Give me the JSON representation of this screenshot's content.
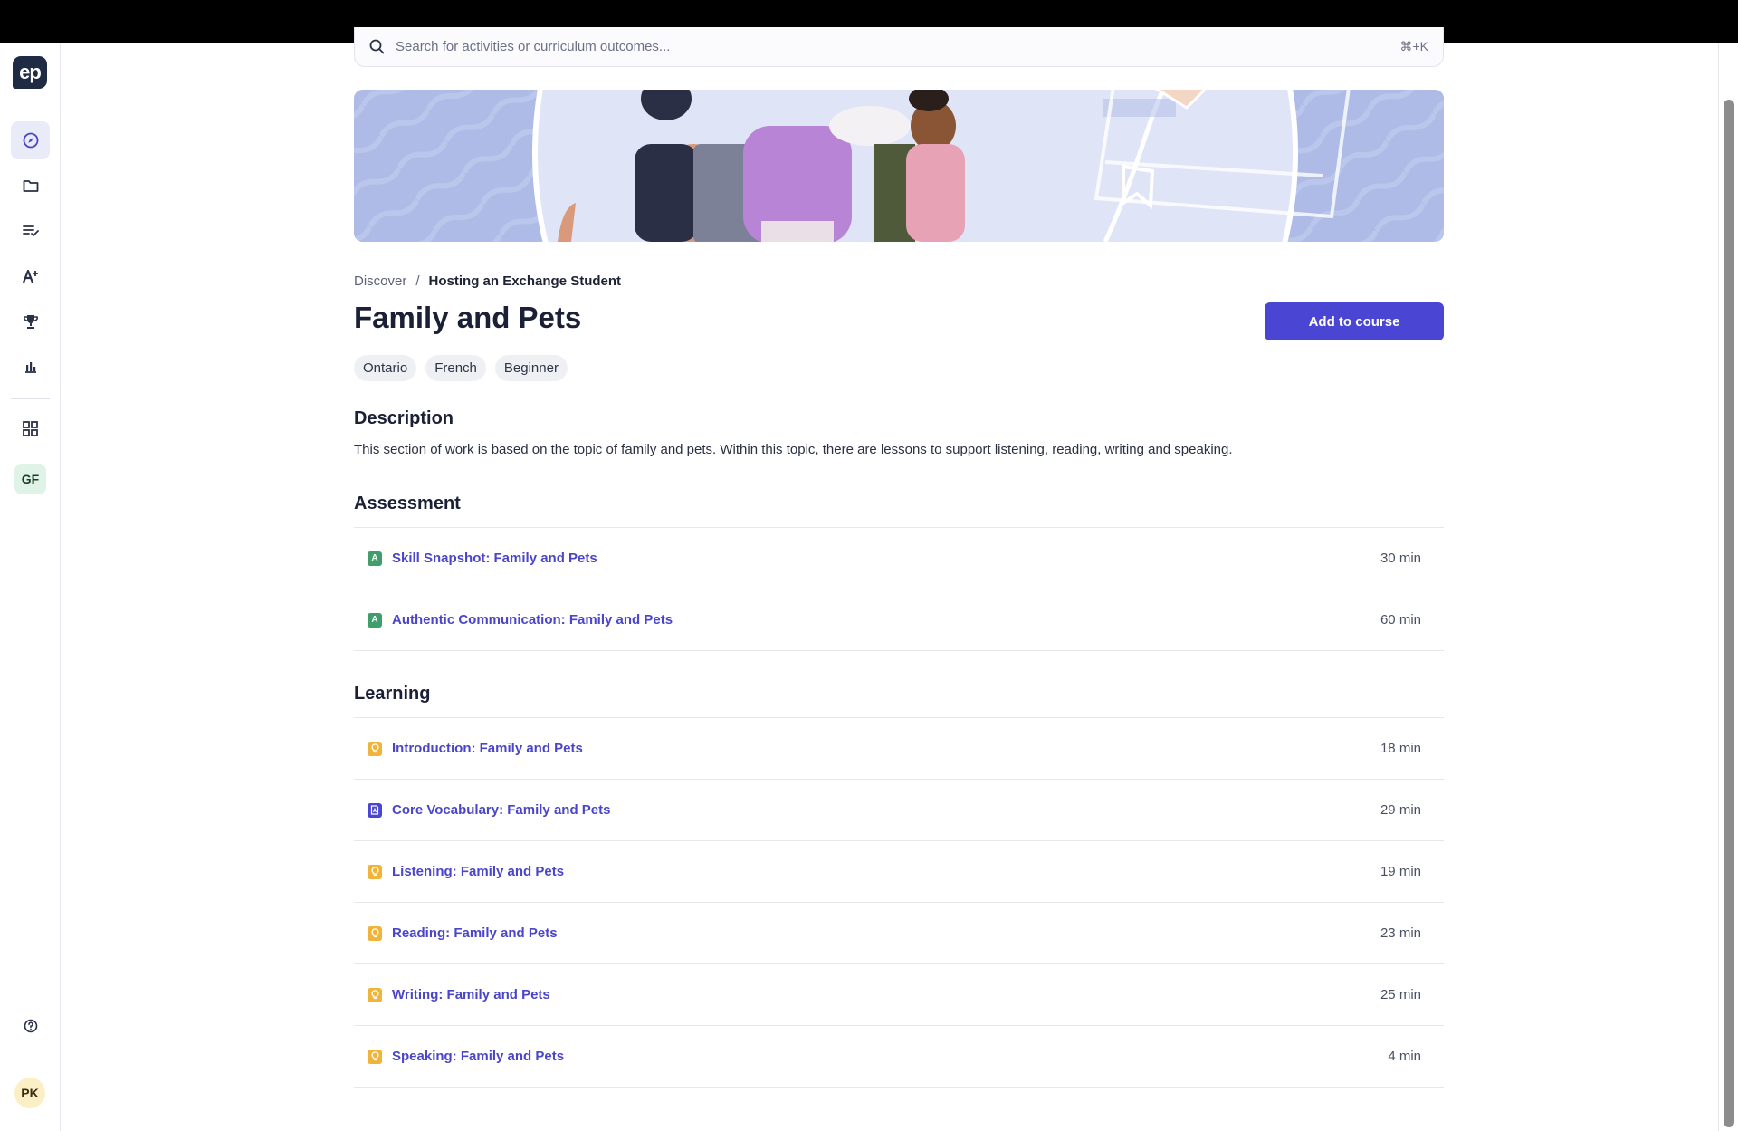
{
  "search": {
    "placeholder": "Search for activities or curriculum outcomes...",
    "shortcut": "⌘+K"
  },
  "sidebar": {
    "logo": "ep",
    "items": [
      {
        "icon": "compass-icon",
        "active": true
      },
      {
        "icon": "folder-icon",
        "active": false
      },
      {
        "icon": "checklist-icon",
        "active": false
      },
      {
        "icon": "grade-icon",
        "active": false
      },
      {
        "icon": "trophy-icon",
        "active": false
      },
      {
        "icon": "bar-chart-icon",
        "active": false
      },
      {
        "icon": "grid-icon",
        "active": false
      }
    ],
    "workspace_badge": "GF",
    "help_icon": "help-icon",
    "user_initials": "PK"
  },
  "breadcrumb": {
    "root": "Discover",
    "separator": "/",
    "current": "Hosting an Exchange Student"
  },
  "page": {
    "title": "Family and Pets",
    "add_button": "Add to course",
    "tags": [
      "Ontario",
      "French",
      "Beginner"
    ]
  },
  "description": {
    "heading": "Description",
    "text": "This section of work is based on the topic of family and pets. Within this topic, there are lessons to support listening, reading, writing and speaking."
  },
  "assessment": {
    "heading": "Assessment",
    "items": [
      {
        "title": "Skill Snapshot: Family and Pets",
        "duration": "30 min",
        "icon": "assessment-icon"
      },
      {
        "title": "Authentic Communication: Family and Pets",
        "duration": "60 min",
        "icon": "assessment-icon"
      }
    ]
  },
  "learning": {
    "heading": "Learning",
    "items": [
      {
        "title": "Introduction: Family and Pets",
        "duration": "18 min",
        "icon": "lightbulb-icon"
      },
      {
        "title": "Core Vocabulary: Family and Pets",
        "duration": "29 min",
        "icon": "vocabulary-icon"
      },
      {
        "title": "Listening: Family and Pets",
        "duration": "19 min",
        "icon": "lightbulb-icon"
      },
      {
        "title": "Reading: Family and Pets",
        "duration": "23 min",
        "icon": "lightbulb-icon"
      },
      {
        "title": "Writing: Family and Pets",
        "duration": "25 min",
        "icon": "lightbulb-icon"
      },
      {
        "title": "Speaking: Family and Pets",
        "duration": "4 min",
        "icon": "lightbulb-icon"
      }
    ]
  },
  "colors": {
    "accent": "#4a45d2",
    "link": "#4a45c9",
    "assessment_icon": "#3f9e6a",
    "learning_icon": "#f1b43a",
    "banner_bg": "#aebbe6"
  }
}
